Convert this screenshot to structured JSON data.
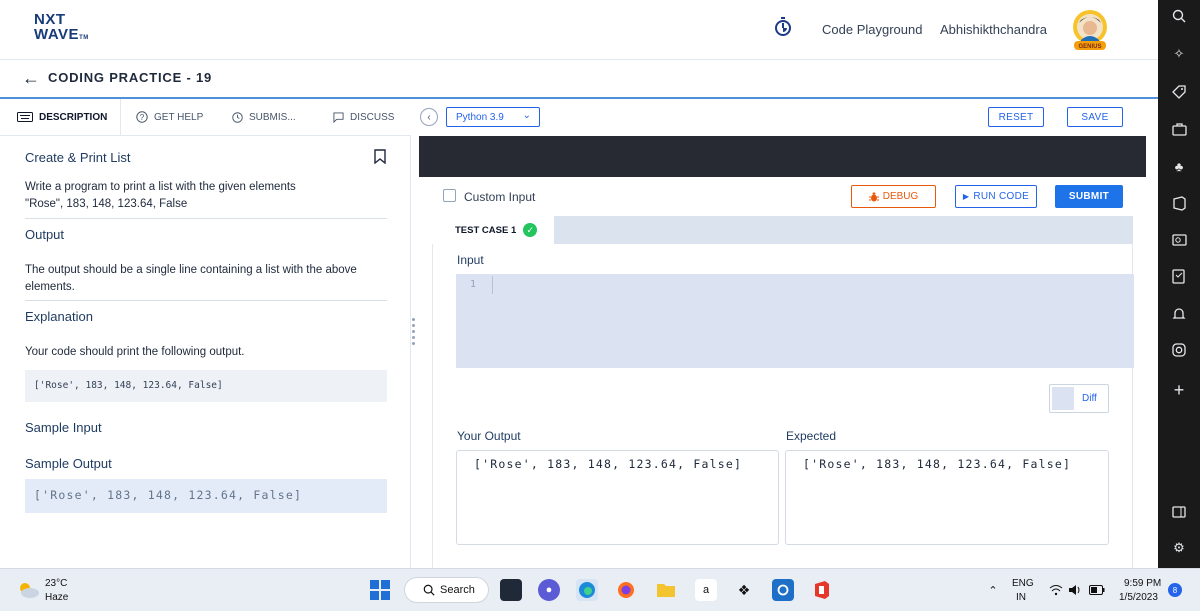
{
  "header": {
    "logo_line1": "NXT",
    "logo_line2": "WAVE",
    "logo_tm": "TM",
    "playground_label": "Code Playground",
    "user_name": "Abhishikthchandra",
    "avatar_badge": "GENIUS"
  },
  "page": {
    "back_glyph": "←",
    "title": "CODING PRACTICE - 19"
  },
  "left_tabs": [
    {
      "label": "DESCRIPTION",
      "icon": "keyboard-icon"
    },
    {
      "label": "GET HELP",
      "icon": "help-circle-icon"
    },
    {
      "label": "SUBMIS...",
      "icon": "clock-icon"
    },
    {
      "label": "DISCUSS",
      "icon": "chat-icon"
    }
  ],
  "description": {
    "title": "Create & Print List",
    "statement_line1": "Write a program to print a list with the given elements",
    "statement_line2": "\"Rose\", 183, 148, 123.64, False",
    "output_heading": "Output",
    "output_text_line1": "The output should be a single line containing a list with the above",
    "output_text_line2": "elements.",
    "explanation_heading": "Explanation",
    "explanation_text": "Your code should print the following output.",
    "explanation_code": "['Rose', 183, 148, 123.64, False]",
    "sample_input_heading": "Sample Input",
    "sample_output_heading": "Sample Output",
    "sample_output_code": "['Rose', 183, 148, 123.64, False]"
  },
  "editor": {
    "collapse_glyph": "‹",
    "language": "Python 3.9",
    "reset_label": "RESET",
    "save_label": "SAVE",
    "custom_input_label": "Custom Input",
    "debug_label": "DEBUG",
    "run_label": "RUN CODE",
    "submit_label": "SUBMIT"
  },
  "test_case": {
    "tab_label": "TEST CASE 1",
    "status": "passed",
    "input_label": "Input",
    "line_number": "1",
    "diff_label": "Diff",
    "your_output_label": "Your Output",
    "your_output": "['Rose', 183, 148, 123.64, False]",
    "expected_label": "Expected",
    "expected_output": "['Rose', 183, 148, 123.64, False]"
  },
  "sidebar_icons": [
    "search-icon",
    "sparkle-icon",
    "tag-icon",
    "briefcase-icon",
    "games-icon",
    "office-icon",
    "outlook-icon",
    "forms-icon",
    "bell-icon",
    "instagram-icon",
    "add-icon",
    "split-view-icon",
    "settings-icon"
  ],
  "taskbar": {
    "weather_temp": "23°C",
    "weather_desc": "Haze",
    "search_label": "Search",
    "lang_line1": "ENG",
    "lang_line2": "IN",
    "time": "9:59 PM",
    "date": "1/5/2023",
    "notification_count": "8"
  },
  "colors": {
    "accent_blue": "#1e73e8",
    "debug_orange": "#ea580c",
    "success_green": "#22c55e",
    "editor_dark": "#272a33",
    "sidebar_dark": "#1a1a1a"
  }
}
